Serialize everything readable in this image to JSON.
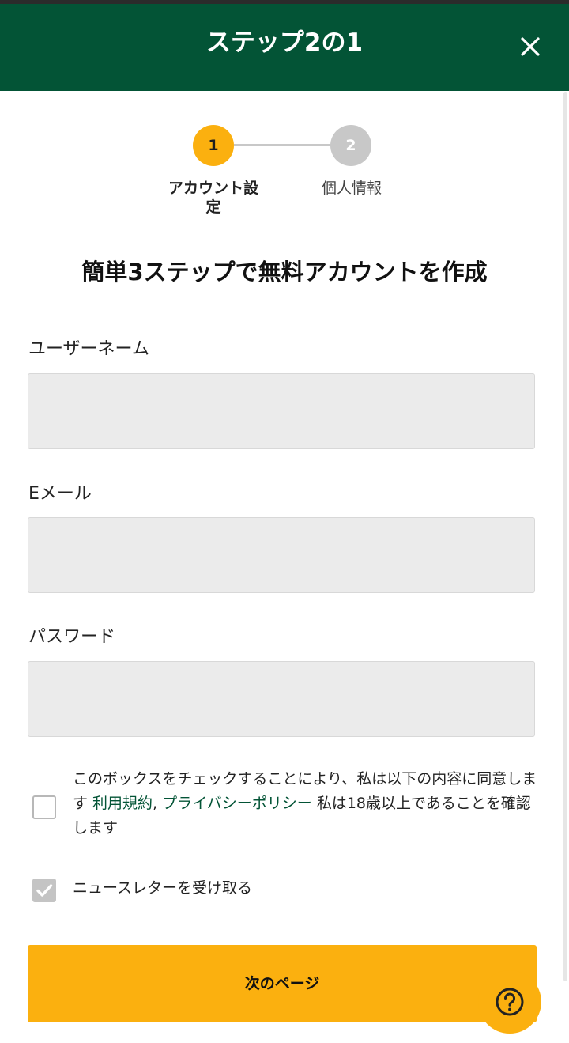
{
  "header": {
    "title": "ステップ2の1",
    "close_icon": "close-icon",
    "background_color": "#035436"
  },
  "stepper": {
    "steps": [
      {
        "number": "1",
        "label": "アカウント設定",
        "label_lines": [
          "アカウント設",
          "定"
        ],
        "state": "active",
        "color": "#fbb00f"
      },
      {
        "number": "2",
        "label": "個人情報",
        "state": "inactive",
        "color": "#c8c8c8"
      }
    ]
  },
  "main": {
    "heading": "簡単3ステップで無料アカウントを作成",
    "fields": [
      {
        "label": "ユーザーネーム",
        "value": "",
        "placeholder": ""
      },
      {
        "label": "Eメール",
        "value": "",
        "placeholder": ""
      },
      {
        "label": "パスワード",
        "value": "",
        "placeholder": ""
      }
    ],
    "terms": {
      "checked": false,
      "text_before": "このボックスをチェックすることにより、私は以下の内容に同意します ",
      "terms_link": "利用規約",
      "separator": ", ",
      "privacy_link": "プライバシーポリシー",
      "text_after": " 私は18歳以上であることを確認します"
    },
    "newsletter": {
      "checked": true,
      "label": "ニュースレターを受け取る"
    },
    "next_button": {
      "label": "次のページ",
      "color": "#fbb00f"
    },
    "help_button": {
      "icon": "question-circle-icon"
    }
  }
}
